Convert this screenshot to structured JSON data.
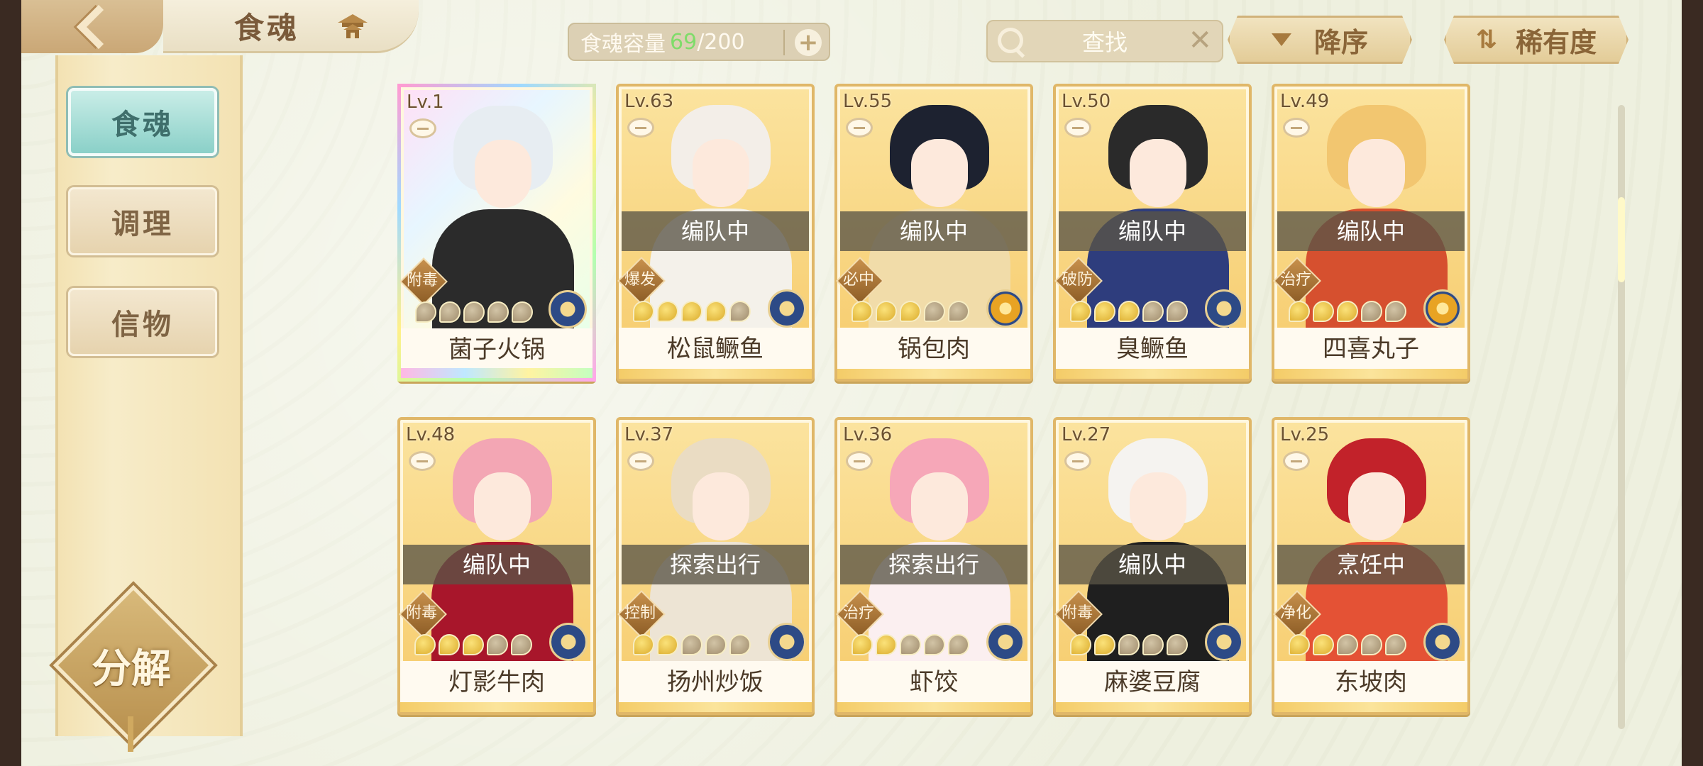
{
  "header": {
    "title": "食魂",
    "capacity_label": "食魂容量",
    "capacity_current": "69",
    "capacity_sep": "/",
    "capacity_max": "200",
    "capacity_add": "+",
    "search_label": "查找",
    "search_clear": "✕",
    "sort_order_label": "降序",
    "sort_rarity_label": "稀有度"
  },
  "sidebar": {
    "items": [
      {
        "label": "食魂",
        "active": true
      },
      {
        "label": "调理",
        "active": false
      },
      {
        "label": "信物",
        "active": false
      }
    ],
    "decompose_label": "分解"
  },
  "cards": [
    {
      "level": "Lv.1",
      "name": "菌子火锅",
      "status": "",
      "role": "附毒",
      "stars": 0,
      "rainbow": true,
      "hair": "#e7edf2",
      "body": "#2b2b2b",
      "element": "water"
    },
    {
      "level": "Lv.63",
      "name": "松鼠鳜鱼",
      "status": "编队中",
      "role": "爆发",
      "stars": 4,
      "rainbow": false,
      "hair": "#f3eee8",
      "body": "#f4f1ea",
      "element": "water"
    },
    {
      "level": "Lv.55",
      "name": "锅包肉",
      "status": "编队中",
      "role": "必中",
      "stars": 3,
      "rainbow": false,
      "hair": "#1d2230",
      "body": "#f1dca9",
      "element": "fire"
    },
    {
      "level": "Lv.50",
      "name": "臭鳜鱼",
      "status": "编队中",
      "role": "破防",
      "stars": 3,
      "rainbow": false,
      "hair": "#2a2a2a",
      "body": "#2e3d7d",
      "element": "water"
    },
    {
      "level": "Lv.49",
      "name": "四喜丸子",
      "status": "编队中",
      "role": "治疗",
      "stars": 3,
      "rainbow": false,
      "hair": "#f2c670",
      "body": "#d6502f",
      "element": "fire"
    },
    {
      "level": "Lv.48",
      "name": "灯影牛肉",
      "status": "编队中",
      "role": "附毒",
      "stars": 3,
      "rainbow": false,
      "hair": "#f3a6b4",
      "body": "#a8162b",
      "element": "water"
    },
    {
      "level": "Lv.37",
      "name": "扬州炒饭",
      "status": "探索出行",
      "role": "控制",
      "stars": 2,
      "rainbow": false,
      "hair": "#eadcc3",
      "body": "#ede4d4",
      "element": "water"
    },
    {
      "level": "Lv.36",
      "name": "虾饺",
      "status": "探索出行",
      "role": "治疗",
      "stars": 2,
      "rainbow": false,
      "hair": "#f6a7b8",
      "body": "#fbeff0",
      "element": "water"
    },
    {
      "level": "Lv.27",
      "name": "麻婆豆腐",
      "status": "编队中",
      "role": "附毒",
      "stars": 2,
      "rainbow": false,
      "hair": "#f5f3f0",
      "body": "#1f1f1f",
      "element": "water"
    },
    {
      "level": "Lv.25",
      "name": "东坡肉",
      "status": "烹饪中",
      "role": "净化",
      "stars": 2,
      "rainbow": false,
      "hair": "#c2222a",
      "body": "#e45235",
      "element": "water"
    }
  ],
  "colors": {
    "accent_green": "#7fdc6a",
    "card_border": "#e0b768",
    "sidebar_active": "#8ad0c8"
  }
}
